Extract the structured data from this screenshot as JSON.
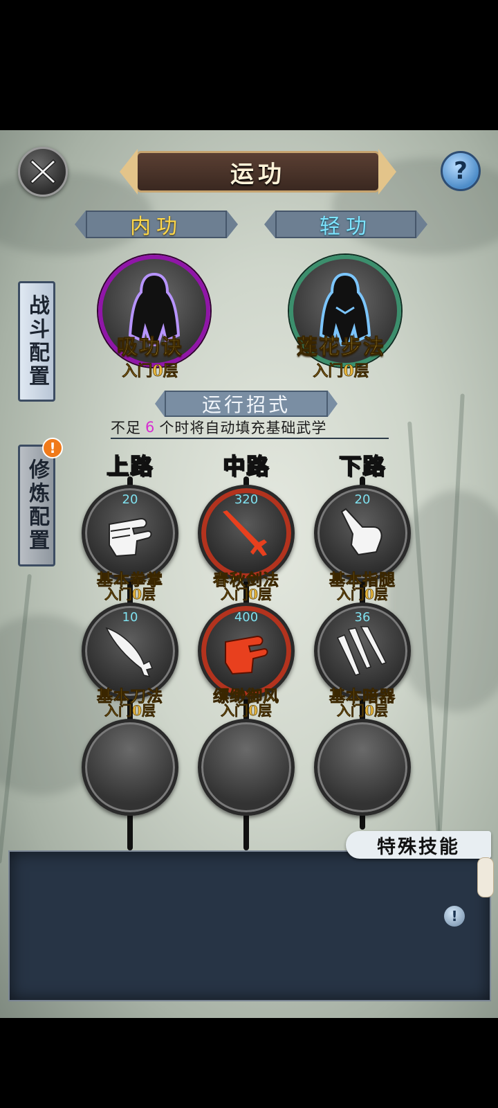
{
  "title": "运功",
  "tabs": [
    {
      "label": "内功"
    },
    {
      "label": "轻功"
    }
  ],
  "side": {
    "battle_config": "战斗配置",
    "training_config": "修炼配置",
    "training_alert": "!"
  },
  "core_skills": [
    {
      "name": "吸功诀",
      "level": "入门0层",
      "ring_color": "#9016a8"
    },
    {
      "name": "莲花步法",
      "level": "入门0层",
      "ring_color": "#3c8f6d"
    }
  ],
  "moves": {
    "header": "运行招式",
    "hint_prefix": "不足",
    "hint_number": "6",
    "hint_suffix": "个时将自动填充基础武学"
  },
  "lanes": [
    "上路",
    "中路",
    "下路"
  ],
  "slots": [
    {
      "count": "20",
      "name": "基本拳掌",
      "level": "入门0层",
      "icon": "fist-icon"
    },
    {
      "count": "320",
      "name": "春秋剑法",
      "level": "入门0层",
      "icon": "sword-icon",
      "highlight": true
    },
    {
      "count": "20",
      "name": "基本指腿",
      "level": "入门0层",
      "icon": "pointing-hand-icon"
    },
    {
      "count": "10",
      "name": "基本刀法",
      "level": "入门0层",
      "icon": "saber-icon"
    },
    {
      "count": "400",
      "name": "缥缈御风",
      "level": "入门0层",
      "icon": "red-fist-icon",
      "highlight": true
    },
    {
      "count": "36",
      "name": "基本暗器",
      "level": "入门0层",
      "icon": "throwing-knives-icon"
    }
  ],
  "special": {
    "label": "特殊技能",
    "info_icon": "!"
  },
  "colors": {
    "hot": "#b3331e",
    "gold": "#f2cf52",
    "count": "#7fe0ee",
    "hint_number": "#d62ed0"
  }
}
